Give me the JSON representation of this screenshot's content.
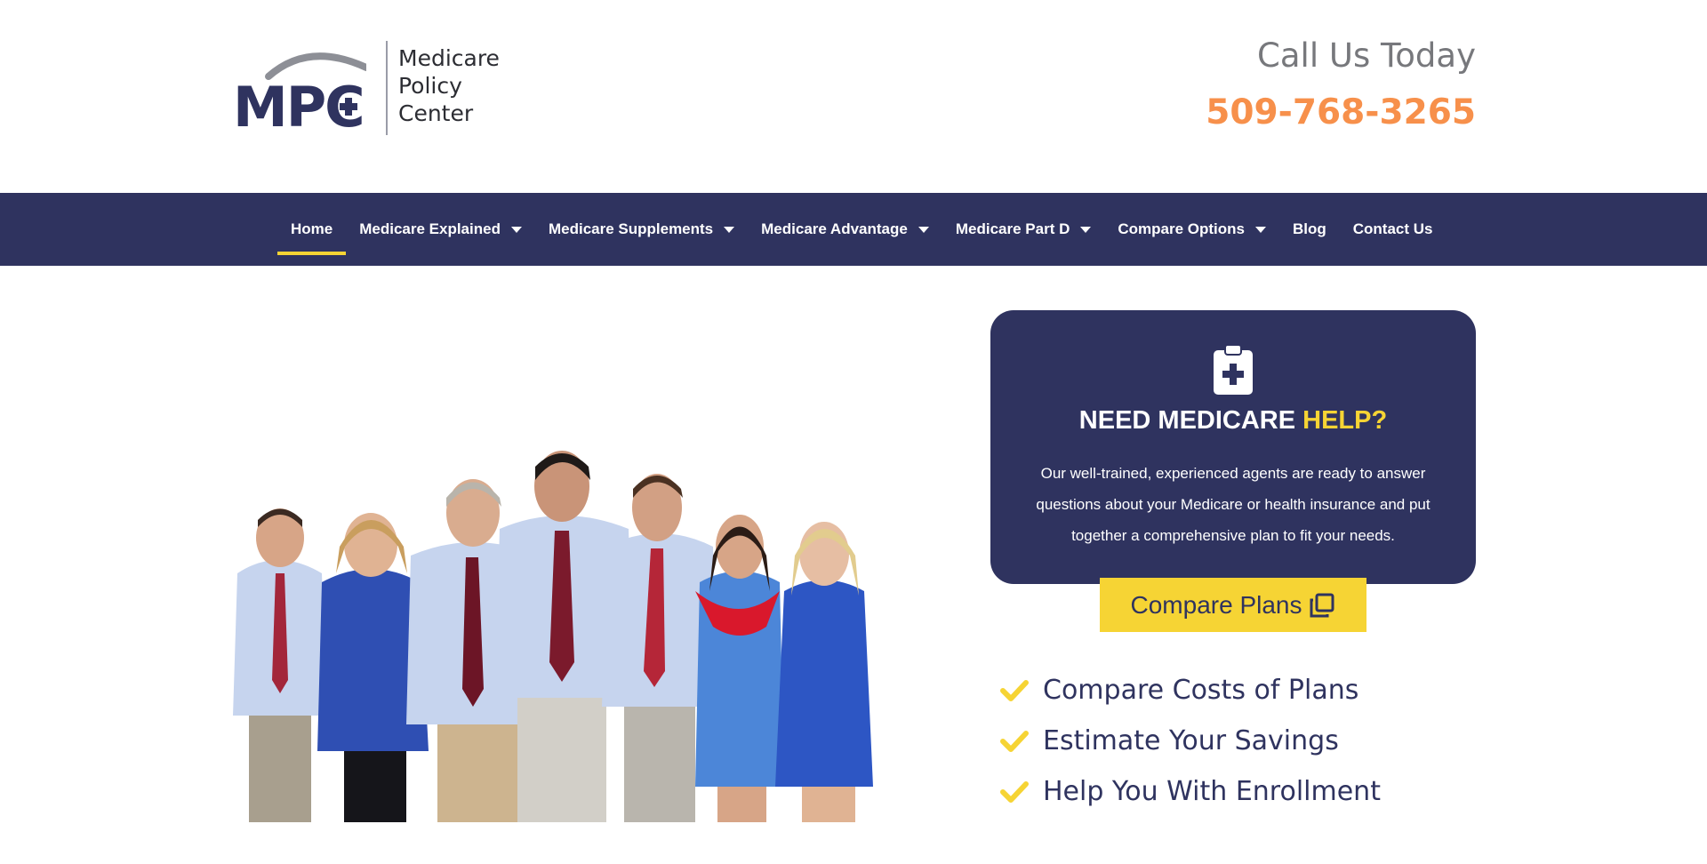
{
  "header": {
    "logo": {
      "mark_text": "MPC",
      "lines": [
        "Medicare",
        "Policy",
        "Center"
      ]
    },
    "call_title": "Call Us Today",
    "phone": "509-768-3265"
  },
  "nav": {
    "items": [
      {
        "label": "Home",
        "active": true,
        "dropdown": false
      },
      {
        "label": "Medicare Explained",
        "active": false,
        "dropdown": true
      },
      {
        "label": "Medicare Supplements",
        "active": false,
        "dropdown": true
      },
      {
        "label": "Medicare Advantage",
        "active": false,
        "dropdown": true
      },
      {
        "label": "Medicare Part D",
        "active": false,
        "dropdown": true
      },
      {
        "label": "Compare Options",
        "active": false,
        "dropdown": true
      },
      {
        "label": "Blog",
        "active": false,
        "dropdown": false
      },
      {
        "label": "Contact Us",
        "active": false,
        "dropdown": false
      }
    ]
  },
  "card": {
    "icon": "clipboard-plus-icon",
    "title_main": "NEED MEDICARE ",
    "title_highlight": "HELP?",
    "text": "Our well-trained, experienced agents are ready to answer questions about your Medicare or health insurance and put together a comprehensive plan to fit your needs."
  },
  "cta": {
    "label": "Compare Plans",
    "icon": "copy-icon"
  },
  "benefits": [
    "Compare Costs of Plans",
    "Estimate Your Savings",
    "Help You With Enrollment"
  ],
  "colors": {
    "navy": "#2f335f",
    "yellow": "#f6d434",
    "orange": "#f7904b",
    "gray": "#77787c"
  }
}
